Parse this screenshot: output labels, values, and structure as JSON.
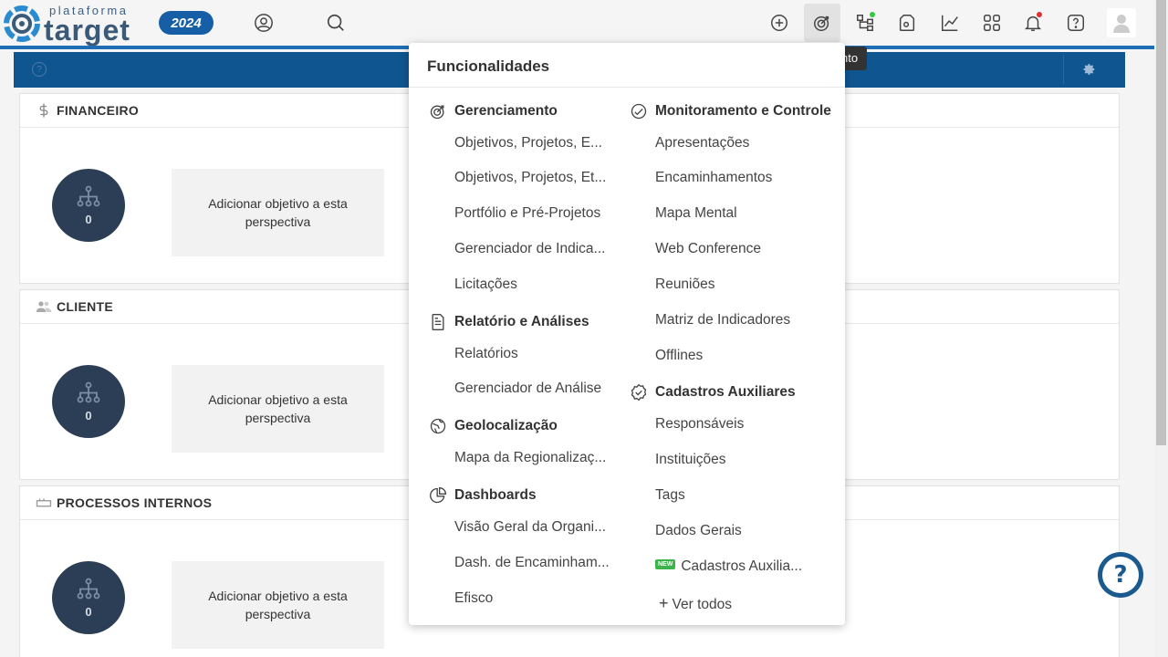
{
  "logo": {
    "small": "plataforma",
    "big": "target"
  },
  "year_badge": "2024",
  "tooltip": "nto",
  "bluebar": {
    "help": "?"
  },
  "cards": [
    {
      "title": "FINANCEIRO",
      "icon": "dollar-icon",
      "count": "0",
      "add_text": "Adicionar objetivo a esta perspectiva"
    },
    {
      "title": "CLIENTE",
      "icon": "users-icon",
      "count": "0",
      "add_text": "Adicionar objetivo a esta perspectiva"
    },
    {
      "title": "PROCESSOS INTERNOS",
      "icon": "process-icon",
      "count": "0",
      "add_text": "Adicionar objetivo a esta perspectiva"
    }
  ],
  "menu": {
    "title": "Funcionalidades",
    "left": {
      "gerenciamento": {
        "label": "Gerenciamento",
        "items": [
          "Objetivos, Projetos, E...",
          "Objetivos, Projetos, Et...",
          "Portfólio e Pré-Projetos",
          "Gerenciador de Indica...",
          "Licitações"
        ]
      },
      "relatorio": {
        "label": "Relatório e Análises",
        "items": [
          "Relatórios",
          "Gerenciador de Análise"
        ]
      },
      "geo": {
        "label": "Geolocalização",
        "items": [
          "Mapa da Regionalizaç..."
        ]
      },
      "dash": {
        "label": "Dashboards",
        "items": [
          "Visão Geral da Organi...",
          "Dash. de Encaminham...",
          "Efisco"
        ]
      }
    },
    "right": {
      "monitoramento": {
        "label": "Monitoramento e Controle",
        "items": [
          "Apresentações",
          "Encaminhamentos",
          "Mapa Mental",
          "Web Conference",
          "Reuniões",
          "Matriz de Indicadores",
          "Offlines"
        ]
      },
      "cadastros": {
        "label": "Cadastros Auxiliares",
        "items": [
          "Responsáveis",
          "Instituições",
          "Tags",
          "Dados Gerais"
        ],
        "new_badge": "NEW",
        "new_item": "Cadastros Auxilia..."
      },
      "ver_todos": "Ver todos"
    }
  },
  "help_bubble": "?"
}
